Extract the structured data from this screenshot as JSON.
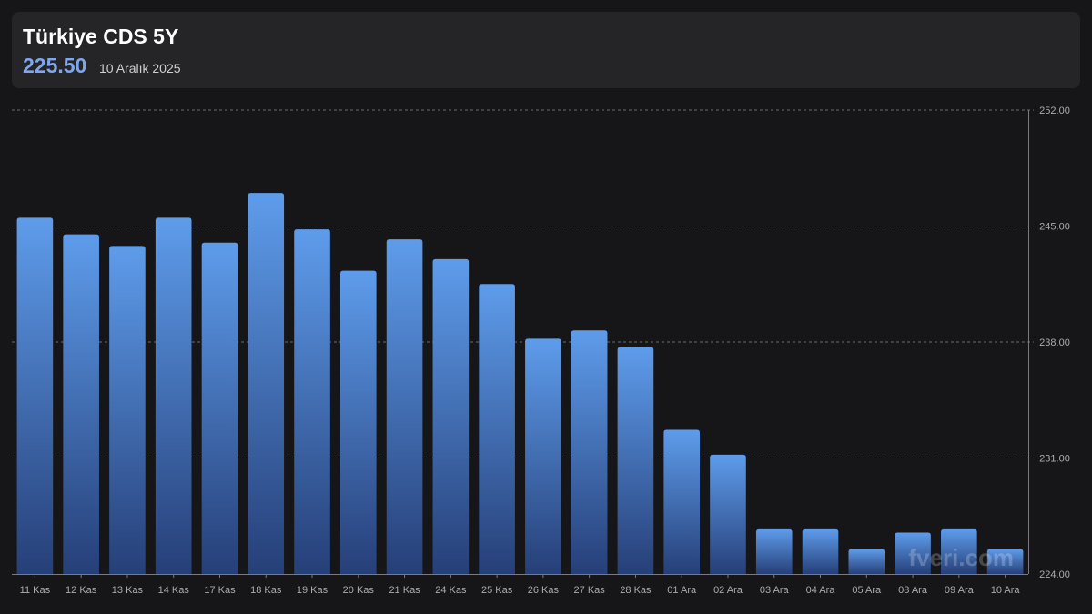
{
  "header": {
    "title": "Türkiye CDS 5Y",
    "value": "225.50",
    "date": "10 Aralık 2025"
  },
  "watermark": "fveri.com",
  "colors": {
    "background": "#161618",
    "header_bg": "#252527",
    "accent": "#7ea7f0",
    "bar_top": "#5e9ceb",
    "bar_bottom": "#263f78"
  },
  "chart_data": {
    "type": "bar",
    "categories": [
      "11 Kas",
      "12 Kas",
      "13 Kas",
      "14 Kas",
      "17 Kas",
      "18 Kas",
      "19 Kas",
      "20 Kas",
      "21 Kas",
      "24 Kas",
      "25 Kas",
      "26 Kas",
      "27 Kas",
      "28 Kas",
      "01 Ara",
      "02 Ara",
      "03 Ara",
      "04 Ara",
      "05 Ara",
      "08 Ara",
      "09 Ara",
      "10 Ara"
    ],
    "values": [
      245.5,
      244.5,
      243.8,
      245.5,
      244.0,
      247.0,
      244.8,
      242.3,
      244.2,
      243.0,
      241.5,
      238.2,
      238.7,
      237.7,
      232.7,
      231.2,
      226.7,
      226.7,
      225.5,
      226.5,
      226.7,
      225.5
    ],
    "ylim": [
      224,
      252
    ],
    "yticks": [
      "224.00",
      "231.00",
      "238.00",
      "245.00",
      "252.00"
    ],
    "grid": true
  }
}
